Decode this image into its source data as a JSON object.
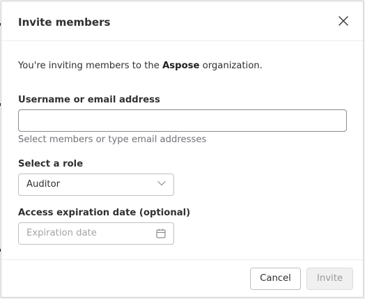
{
  "dialog": {
    "title": "Invite members",
    "intro_prefix": "You're inviting members to the ",
    "organization": "Aspose",
    "intro_suffix": " organization."
  },
  "fields": {
    "username": {
      "label": "Username or email address",
      "value": "",
      "help": "Select members or type email addresses"
    },
    "role": {
      "label": "Select a role",
      "selected": "Auditor"
    },
    "expiration": {
      "label": "Access expiration date (optional)",
      "placeholder": "Expiration date",
      "value": ""
    }
  },
  "footer": {
    "cancel_label": "Cancel",
    "invite_label": "Invite"
  },
  "icons": {
    "close": "close-icon",
    "chevron": "chevron-down-icon",
    "calendar": "calendar-icon"
  },
  "colors": {
    "text": "#303030",
    "help_text": "#737278",
    "placeholder": "#a4a3a8",
    "border": "#bfbfc3",
    "disabled_button_bg": "#f0f0f0"
  }
}
